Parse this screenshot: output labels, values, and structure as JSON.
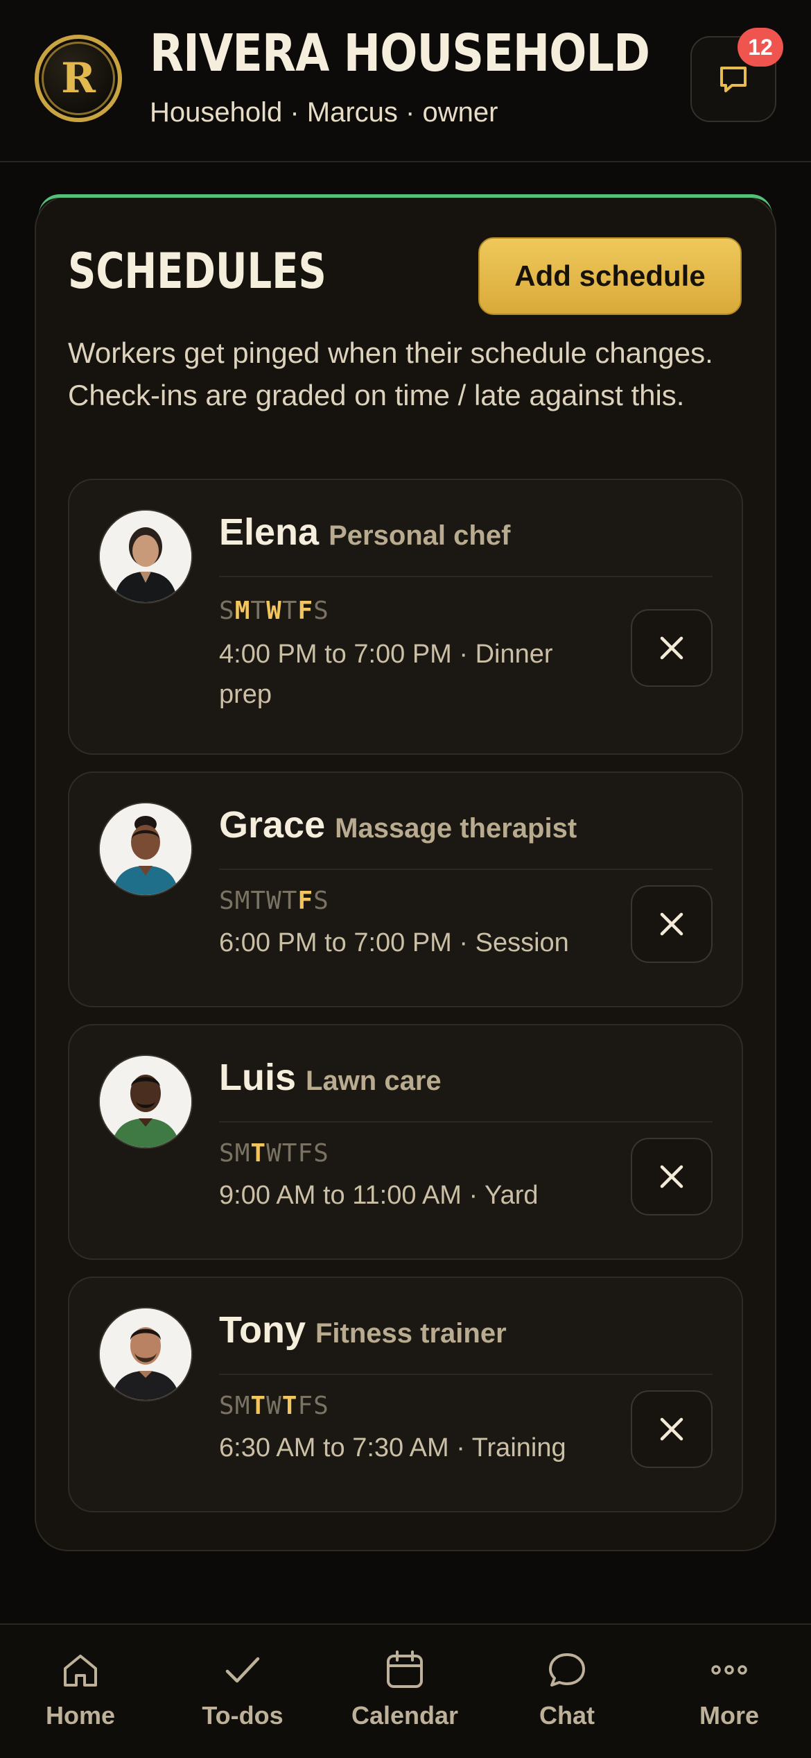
{
  "header": {
    "logo_letter": "R",
    "title": "RIVERA HOUSEHOLD",
    "subtitle": "Household · Marcus · owner",
    "chat_badge": "12"
  },
  "schedules": {
    "title": "SCHEDULES",
    "add_label": "Add schedule",
    "description": "Workers get pinged when their schedule changes. Check-ins are graded on time / late against this.",
    "day_letters": [
      "S",
      "M",
      "T",
      "W",
      "T",
      "F",
      "S"
    ],
    "items": [
      {
        "name": "Elena",
        "role": "Personal chef",
        "active_days": [
          false,
          true,
          false,
          true,
          false,
          true,
          false
        ],
        "time": "4:00 PM to 7:00 PM · Dinner prep"
      },
      {
        "name": "Grace",
        "role": "Massage therapist",
        "active_days": [
          false,
          false,
          false,
          false,
          false,
          true,
          false
        ],
        "time": "6:00 PM to 7:00 PM · Session"
      },
      {
        "name": "Luis",
        "role": "Lawn care",
        "active_days": [
          false,
          false,
          true,
          false,
          false,
          false,
          false
        ],
        "time": "9:00 AM to 11:00 AM · Yard"
      },
      {
        "name": "Tony",
        "role": "Fitness trainer",
        "active_days": [
          false,
          false,
          true,
          false,
          true,
          false,
          false
        ],
        "time": "6:30 AM to 7:30 AM · Training"
      }
    ]
  },
  "nav": {
    "items": [
      {
        "label": "Home",
        "icon": "home-icon"
      },
      {
        "label": "To-dos",
        "icon": "check-icon"
      },
      {
        "label": "Calendar",
        "icon": "calendar-icon"
      },
      {
        "label": "Chat",
        "icon": "chat-bubble-icon"
      },
      {
        "label": "More",
        "icon": "more-dots-icon"
      }
    ]
  },
  "colors": {
    "accent_gold": "#f2c65c",
    "panel_accent_green": "#52c27a",
    "badge_red": "#f0544e",
    "inactive_day": "#7a7263"
  }
}
